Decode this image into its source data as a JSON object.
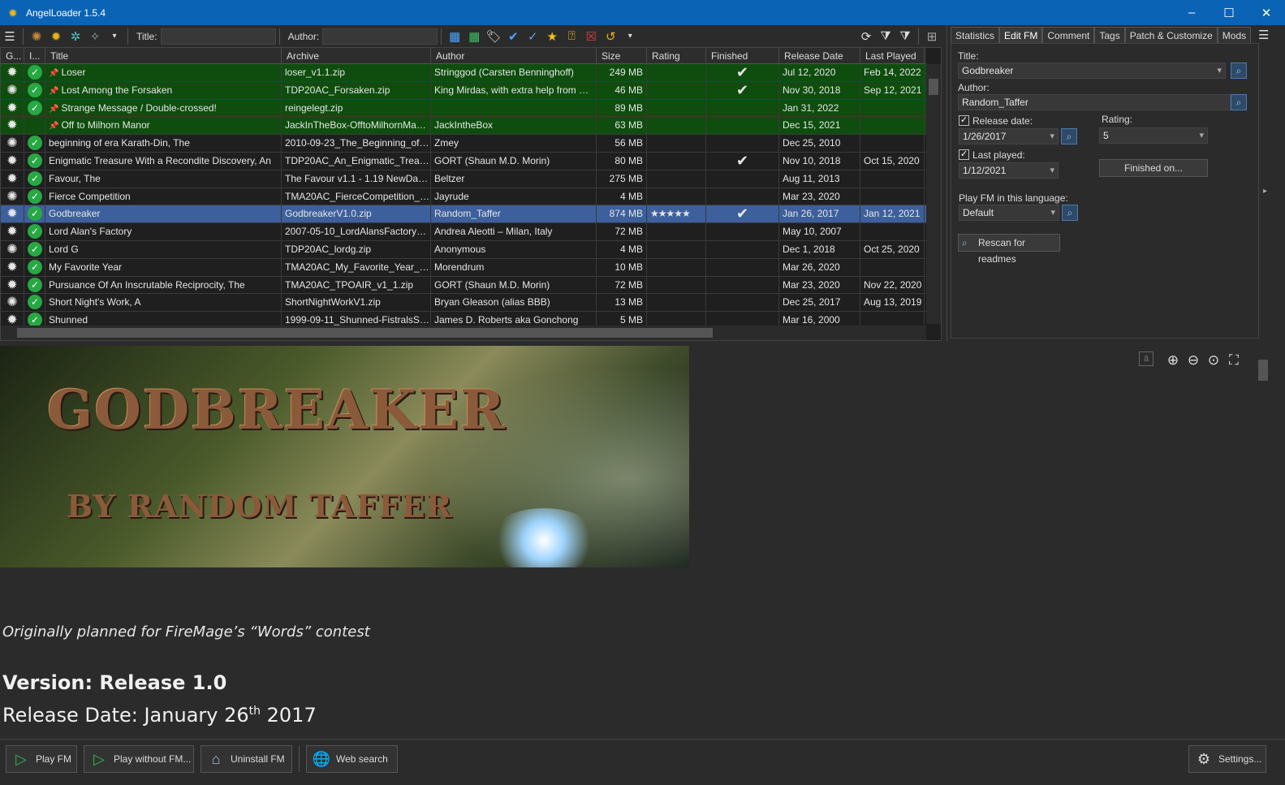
{
  "window": {
    "title": "AngelLoader 1.5.4"
  },
  "toolbar": {
    "title_label": "Title:",
    "author_label": "Author:",
    "title_value": "",
    "author_value": ""
  },
  "grid": {
    "columns": [
      "G...",
      "I...",
      "Title",
      "Archive",
      "Author",
      "Size",
      "Rating",
      "Finished",
      "Release Date",
      "Last Played"
    ],
    "rows": [
      {
        "title": "Loser",
        "pinned": true,
        "archive": "loser_v1.1.zip",
        "author": "Stringgod (Carsten Benninghoff)",
        "size": "249 MB",
        "rating": "",
        "finished": true,
        "release": "Jul 12, 2020",
        "played": "Feb 14, 2022",
        "installed": true,
        "style": "green"
      },
      {
        "title": "Lost Among the Forsaken",
        "pinned": true,
        "archive": "TDP20AC_Forsaken.zip",
        "author": "King Mirdas, with extra help from Gwona...",
        "size": "46 MB",
        "rating": "",
        "finished": true,
        "release": "Nov 30, 2018",
        "played": "Sep 12, 2021",
        "installed": true,
        "style": "green"
      },
      {
        "title": "Strange Message / Double-crossed!",
        "pinned": true,
        "archive": "reingelegt.zip",
        "author": "",
        "size": "89 MB",
        "rating": "",
        "finished": false,
        "release": "Jan 31, 2022",
        "played": "",
        "installed": true,
        "style": "green"
      },
      {
        "title": "Off to Milhorn Manor",
        "pinned": true,
        "archive": "JackInTheBox-OfftoMilhornManor-3...",
        "author": "JackIntheBox",
        "size": "63 MB",
        "rating": "",
        "finished": false,
        "release": "Dec 15, 2021",
        "played": "",
        "installed": false,
        "style": "green"
      },
      {
        "title": "beginning of era Karath-Din, The",
        "pinned": false,
        "archive": "2010-09-23_The_Beginning_of_Era...",
        "author": "Zmey",
        "size": "56 MB",
        "rating": "",
        "finished": false,
        "release": "Dec 25, 2010",
        "played": "",
        "installed": true,
        "style": ""
      },
      {
        "title": "Enigmatic Treasure With a Recondite Discovery, An",
        "pinned": false,
        "archive": "TDP20AC_An_Enigmatic_Treasure...",
        "author": "GORT (Shaun M.D. Morin)",
        "size": "80 MB",
        "rating": "",
        "finished": true,
        "release": "Nov 10, 2018",
        "played": "Oct 15, 2020",
        "installed": true,
        "style": ""
      },
      {
        "title": "Favour, The",
        "pinned": false,
        "archive": "The Favour v1.1 - 1.19 NewDark.zip",
        "author": "Beltzer",
        "size": "275 MB",
        "rating": "",
        "finished": false,
        "release": "Aug 11, 2013",
        "played": "",
        "installed": true,
        "style": ""
      },
      {
        "title": "Fierce Competition",
        "pinned": false,
        "archive": "TMA20AC_FierceCompetition_v1_1...",
        "author": "Jayrude",
        "size": "4 MB",
        "rating": "",
        "finished": false,
        "release": "Mar 23, 2020",
        "played": "",
        "installed": true,
        "style": ""
      },
      {
        "title": "Godbreaker",
        "pinned": false,
        "archive": "GodbreakerV1.0.zip",
        "author": "Random_Taffer",
        "size": "874 MB",
        "rating": "★★★★★",
        "finished": true,
        "release": "Jan 26, 2017",
        "played": "Jan 12, 2021",
        "installed": true,
        "style": "sel"
      },
      {
        "title": "Lord Alan's Factory",
        "pinned": false,
        "archive": "2007-05-10_LordAlansFactory_v1.zip",
        "author": "Andrea Aleotti – Milan, Italy",
        "size": "72 MB",
        "rating": "",
        "finished": false,
        "release": "May 10, 2007",
        "played": "",
        "installed": true,
        "style": ""
      },
      {
        "title": "Lord G",
        "pinned": false,
        "archive": "TDP20AC_lordg.zip",
        "author": "Anonymous",
        "size": "4 MB",
        "rating": "",
        "finished": false,
        "release": "Dec 1, 2018",
        "played": "Oct 25, 2020",
        "installed": true,
        "style": ""
      },
      {
        "title": "My Favorite Year",
        "pinned": false,
        "archive": "TMA20AC_My_Favorite_Year_v1_...",
        "author": "Morendrum",
        "size": "10 MB",
        "rating": "",
        "finished": false,
        "release": "Mar 26, 2020",
        "played": "",
        "installed": true,
        "style": ""
      },
      {
        "title": "Pursuance Of An Inscrutable Reciprocity, The",
        "pinned": false,
        "archive": "TMA20AC_TPOAIR_v1_1.zip",
        "author": "GORT (Shaun M.D. Morin)",
        "size": "72 MB",
        "rating": "",
        "finished": false,
        "release": "Mar 23, 2020",
        "played": "Nov 22, 2020",
        "installed": true,
        "style": ""
      },
      {
        "title": "Short Night's Work, A",
        "pinned": false,
        "archive": "ShortNightWorkV1.zip",
        "author": "Bryan Gleason (alias BBB)",
        "size": "13 MB",
        "rating": "",
        "finished": false,
        "release": "Dec 25, 2017",
        "played": "Aug 13, 2019",
        "installed": true,
        "style": ""
      },
      {
        "title": "Shunned",
        "pinned": false,
        "archive": "1999-09-11_Shunned-FistralsStory.zip",
        "author": "James D. Roberts aka Gonchong",
        "size": "5 MB",
        "rating": "",
        "finished": false,
        "release": "Mar 16, 2000",
        "played": "",
        "installed": true,
        "style": ""
      }
    ]
  },
  "side": {
    "tabs": [
      "Statistics",
      "Edit FM",
      "Comment",
      "Tags",
      "Patch & Customize",
      "Mods"
    ],
    "active_tab": "Edit FM",
    "title_label": "Title:",
    "title_value": "Godbreaker",
    "author_label": "Author:",
    "author_value": "Random_Taffer",
    "release_label": "Release date:",
    "release_value": "1/26/2017",
    "rating_label": "Rating:",
    "rating_value": "5",
    "played_label": "Last played:",
    "played_value": "1/12/2021",
    "finished_btn": "Finished on...",
    "lang_label": "Play FM in this language:",
    "lang_value": "Default",
    "rescan_btn": "Rescan for readmes"
  },
  "readme": {
    "banner_title": "GODBREAKER",
    "banner_sub": "BY RANDOM TAFFER",
    "line1": "Originally planned for FireMage’s “Words” contest",
    "line2": "Version: Release 1.0",
    "line3_pre": "Release Date:  January 26",
    "line3_sup": "th",
    "line3_post": " 2017",
    "encoding_icon": "á"
  },
  "bottom": {
    "play": "Play FM",
    "play_without": "Play without FM...",
    "uninstall": "Uninstall FM",
    "web_search": "Web search",
    "settings": "Settings..."
  },
  "colors": {
    "accent": "#0b63b6",
    "green_row": "#0e4d0e",
    "selected_row": "#3d5f9c",
    "finished_check": "#e02424",
    "star": "#f1c40f"
  }
}
